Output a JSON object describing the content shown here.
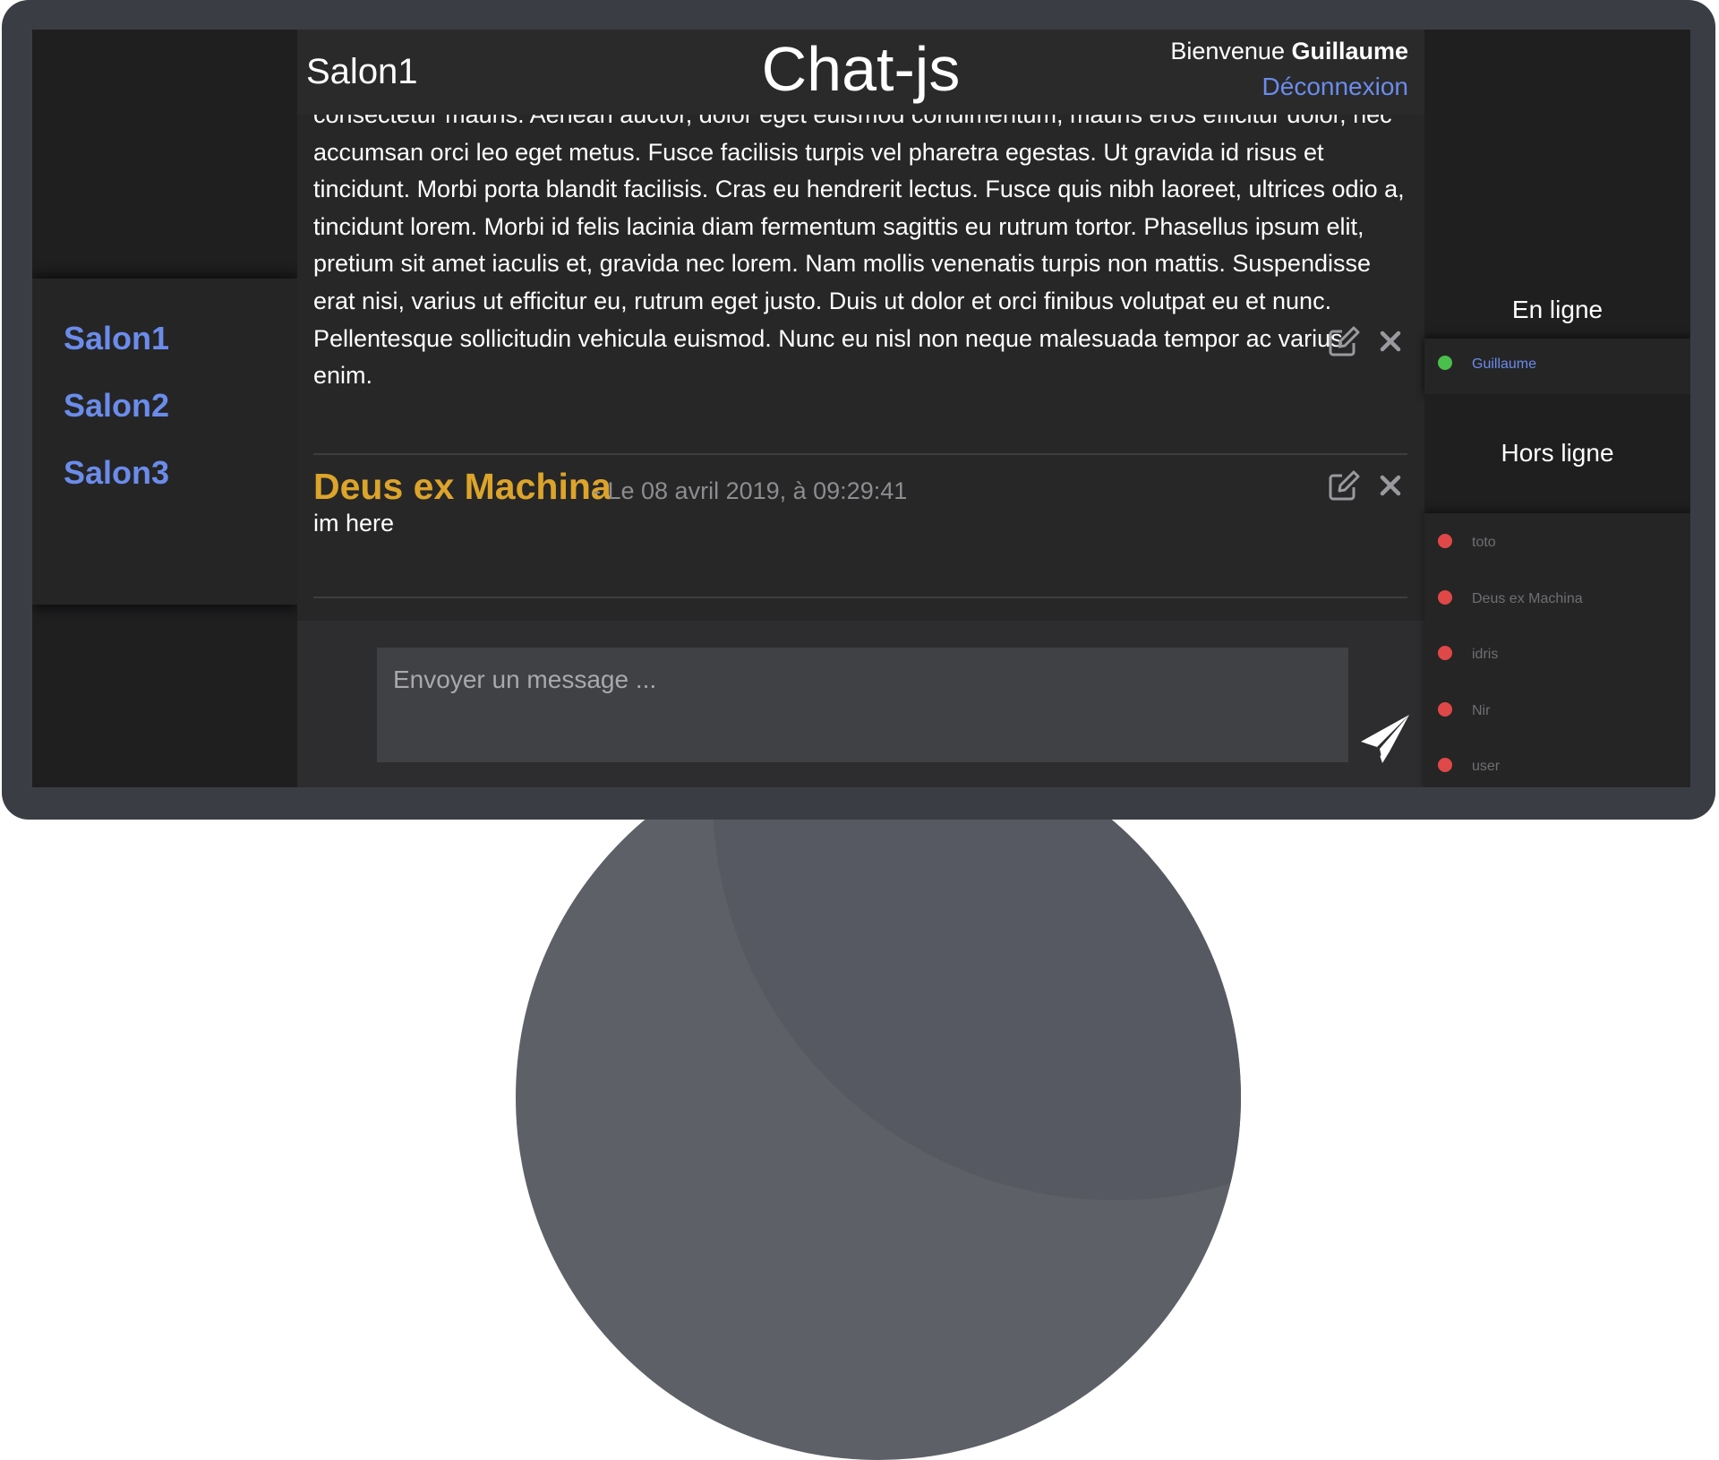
{
  "header": {
    "room_title": "Salon1",
    "app_title": "Chat-js",
    "welcome_prefix": "Bienvenue ",
    "username": "Guillaume",
    "logout_label": "Déconnexion"
  },
  "rooms": [
    {
      "label": "Salon1"
    },
    {
      "label": "Salon2"
    },
    {
      "label": "Salon3"
    }
  ],
  "messages": [
    {
      "text": "consectetur mauris. Aenean auctor, dolor eget euismod condimentum, mauris eros efficitur dolor, nec accumsan orci leo eget metus. Fusce facilisis turpis vel pharetra egestas. Ut gravida id risus et tincidunt. Morbi porta blandit facilisis. Cras eu hendrerit lectus. Fusce quis nibh laoreet, ultrices odio a, tincidunt lorem. Morbi id felis lacinia diam fermentum sagittis eu rutrum tortor. Phasellus ipsum elit, pretium sit amet iaculis et, gravida nec lorem. Nam mollis venenatis turpis non mattis. Suspendisse erat nisi, varius ut efficitur eu, rutrum eget justo. Duis ut dolor et orci finibus volutpat eu et nunc. Pellentesque sollicitudin vehicula euismod. Nunc eu nisl non neque malesuada tempor ac varius enim."
    },
    {
      "author": "Deus ex Machina",
      "meta": "- Le 08 avril 2019, à 09:29:41",
      "text": "im here"
    }
  ],
  "composer": {
    "placeholder": "Envoyer un message ..."
  },
  "online": {
    "title": "En ligne",
    "users": [
      {
        "name": "Guillaume"
      }
    ]
  },
  "offline": {
    "title": "Hors ligne",
    "users": [
      {
        "name": "toto"
      },
      {
        "name": "Deus ex Machina"
      },
      {
        "name": "idris"
      },
      {
        "name": "Nir"
      },
      {
        "name": "user"
      }
    ]
  },
  "colors": {
    "accent_link": "#6b8cea",
    "author": "#dca42a",
    "online_dot": "#4bbf4b",
    "offline_dot": "#e04848",
    "online_name": "#6b8cea",
    "offline_name": "#6f6f73"
  },
  "icons": {
    "edit": "edit-icon",
    "delete": "close-icon",
    "send": "paper-plane-icon"
  }
}
